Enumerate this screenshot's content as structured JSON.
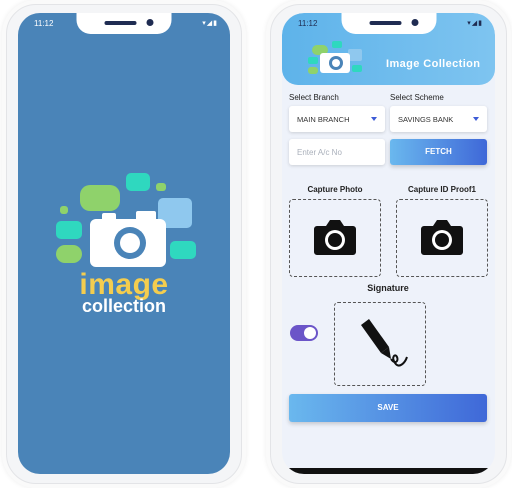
{
  "status": {
    "time": "11:12",
    "icons": "▾◢▮"
  },
  "splash": {
    "logo_word1": "image",
    "logo_word2": "collection",
    "colors": {
      "background": "#4a84b8",
      "yellow": "#f4cd4f"
    }
  },
  "app": {
    "title": "Image Collection",
    "branch": {
      "label": "Select Branch",
      "value": "MAIN BRANCH"
    },
    "scheme": {
      "label": "Select Scheme",
      "value": "SAVINGS BANK"
    },
    "account_input": {
      "placeholder": "Enter A/c No",
      "value": ""
    },
    "fetch_label": "FETCH",
    "capture_photo_label": "Capture Photo",
    "capture_id_label": "Capture ID Proof1",
    "signature_label": "Signature",
    "toggle_on": true,
    "save_label": "SAVE",
    "colors": {
      "accent": "#3f68d8",
      "header": "#5eb3ea",
      "toggle": "#6b55c8"
    }
  }
}
